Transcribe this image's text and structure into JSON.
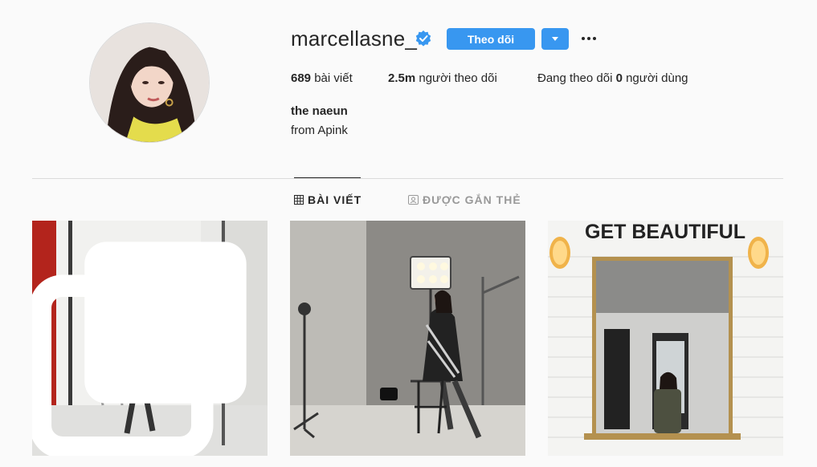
{
  "profile": {
    "username": "marcellasne_",
    "verified": true,
    "follow_label": "Theo dõi",
    "stats": {
      "posts_count": "689",
      "posts_label": "bài viết",
      "followers_count": "2.5m",
      "followers_label": "người theo dõi",
      "following_prefix": "Đang theo dõi",
      "following_count": "0",
      "following_suffix": "người dùng"
    },
    "full_name": "the naeun",
    "bio": "from Apink"
  },
  "tabs": [
    {
      "label": "BÀI VIẾT",
      "icon": "grid-icon",
      "active": true
    },
    {
      "label": "ĐƯỢC GẮN THẺ",
      "icon": "tagged-icon",
      "active": false
    }
  ],
  "posts": [
    {
      "name": "post-1",
      "multi": true
    },
    {
      "name": "post-2",
      "multi": false
    },
    {
      "name": "post-3",
      "multi": false,
      "sign_text": "GET BEAUTIFUL"
    }
  ],
  "colors": {
    "accent": "#3897f0",
    "verified": "#3897f0",
    "text": "#262626",
    "muted": "#999999",
    "background": "#fafafa",
    "divider": "#dbdbdb"
  }
}
